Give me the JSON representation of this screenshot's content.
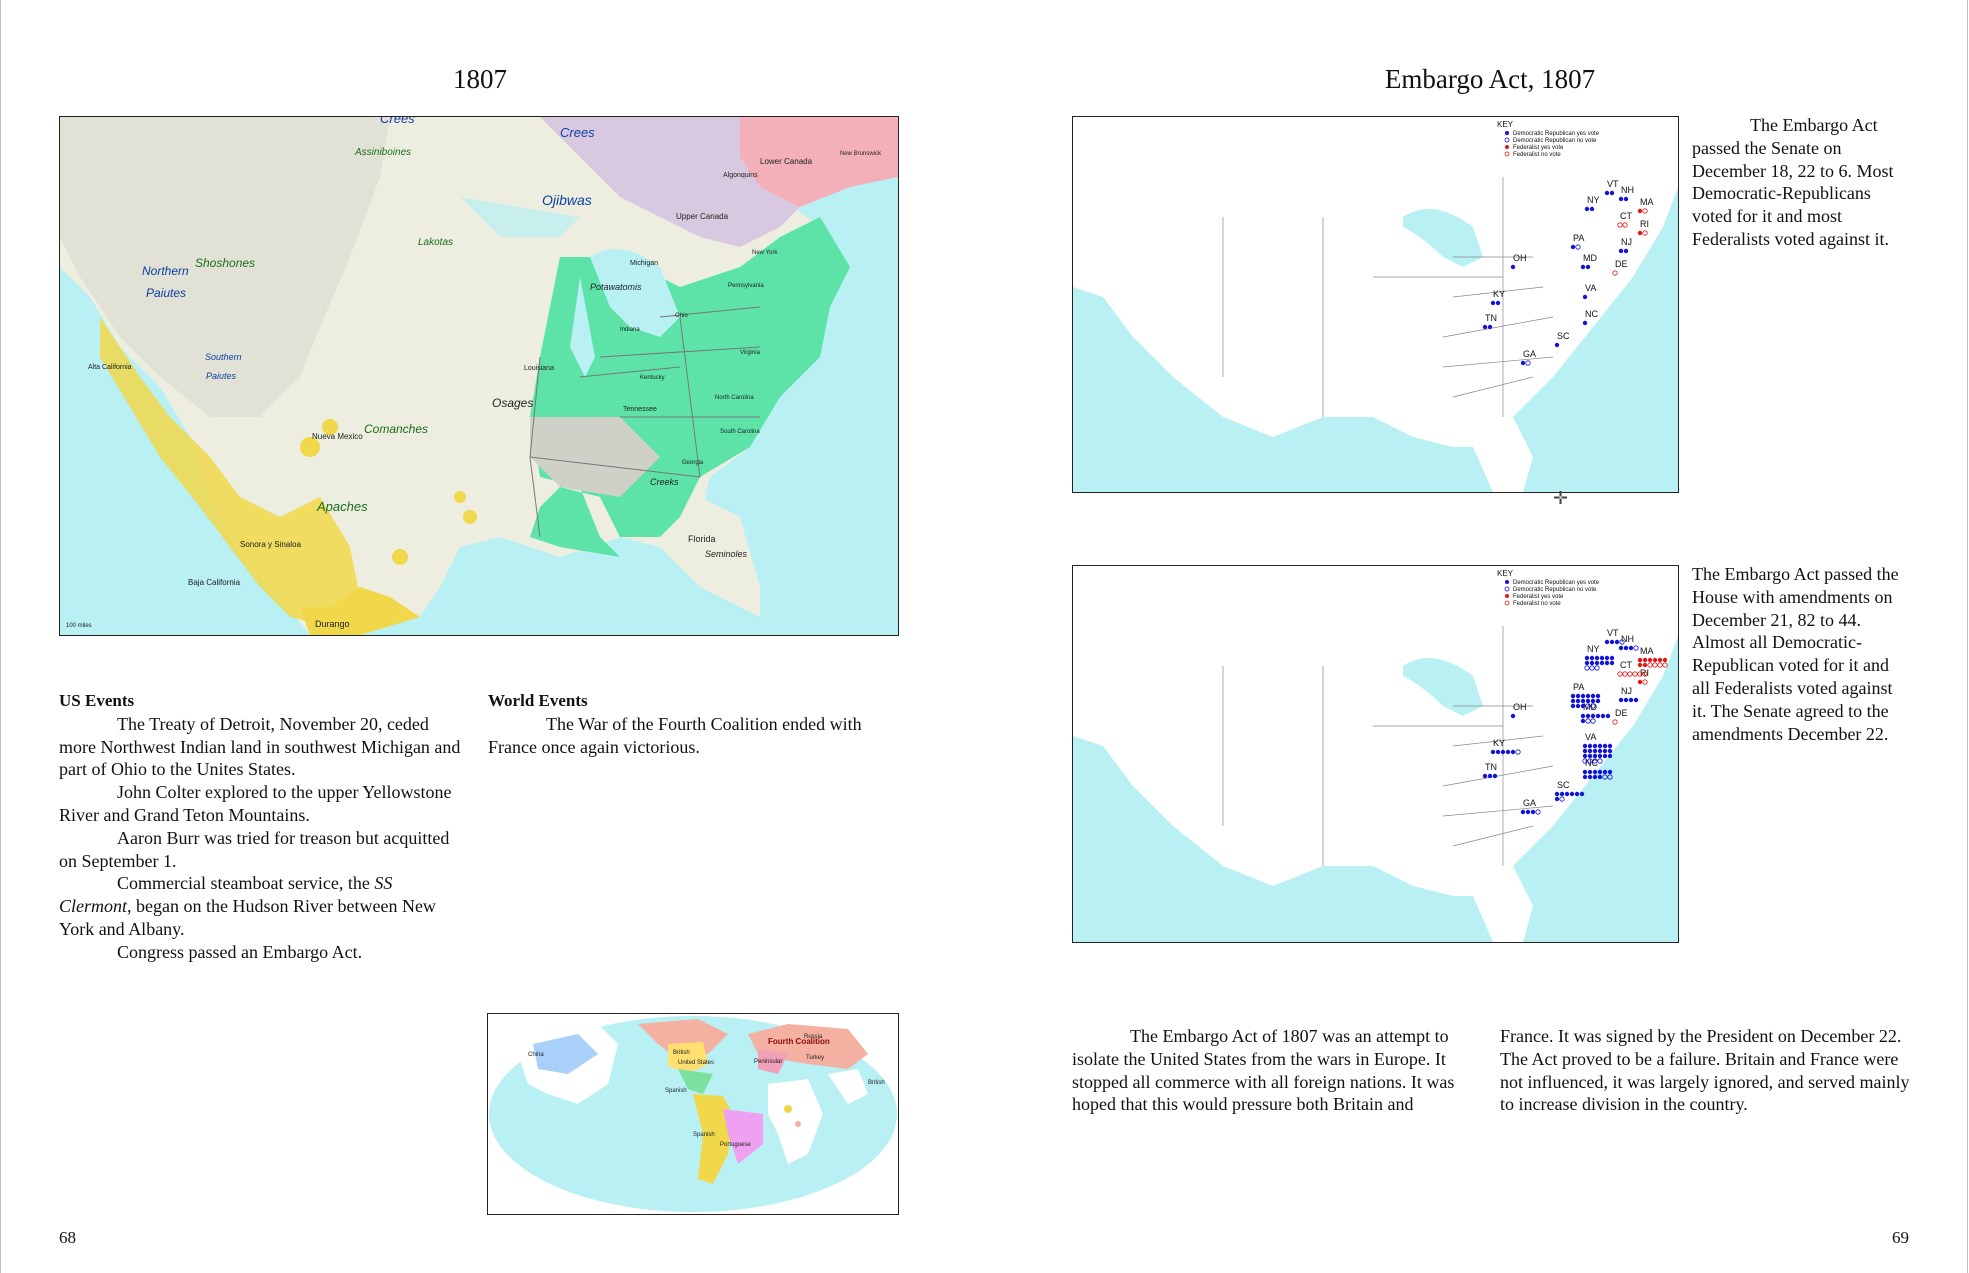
{
  "left_page": {
    "title": "1807",
    "page_number": "68",
    "us_events_heading": "US Events",
    "us_events": [
      "The Treaty of Detroit, November 20, ceded more Northwest Indian land in southwest Michigan and part of Ohio to the Unites States.",
      "John Colter explored to the upper Yellowstone River and Grand Teton Mountains.",
      "Aaron Burr was tried for treason but acquitted on September 1.",
      "Commercial steamboat service, the ",
      "SS Clermont",
      ", began on the Hudson River between New York and Albany.",
      "Congress passed an Embargo Act."
    ],
    "world_events_heading": "World Events",
    "world_events": [
      "The War of the Fourth Coalition ended with France once again victorious."
    ],
    "us_map_labels": {
      "crees_top": "Crees",
      "crees": "Crees",
      "assiniboines": "Assiniboines",
      "ojibwas": "Ojibwas",
      "shoshones": "Shoshones",
      "northern": "Northern",
      "paiutes": "Paiutes",
      "southern": "Southern",
      "paiutes2": "Paiutes",
      "comanches": "Comanches",
      "apaches": "Apaches",
      "osages": "Osages",
      "lakotas": "Lakotas",
      "potawatomis": "Potawatomis",
      "creeks": "Creeks",
      "seminoles": "Seminoles",
      "lower_canada": "Lower Canada",
      "upper_canada": "Upper Canada",
      "algonquins": "Algonquins",
      "new_brunswick": "New Brunswick",
      "michigan": "Michigan",
      "ohio": "Ohio",
      "indiana": "Indiana",
      "kentucky": "Kentucky",
      "tennessee": "Tennessee",
      "north_carolina": "North Carolina",
      "south_carolina": "South Carolina",
      "georgia": "Georgia",
      "virginia": "Virginia",
      "pennsylvania": "Pennsylvania",
      "new_york": "New York",
      "louisiana": "Louisiana",
      "nueva_mexico": "Nueva Mexico",
      "sonora": "Sonora y Sinaloa",
      "baja": "Baja California",
      "alta_california": "Alta California",
      "florida": "Florida",
      "durango": "Durango",
      "scale": "100 miles"
    },
    "world_map_labels": {
      "china": "China",
      "british": "British",
      "united_states": "United States",
      "spanish": "Spanish",
      "spanish2": "Spanish",
      "portuguese": "Portuguese",
      "fourth_coalition": "Fourth Coalition",
      "peninsular": "Peninsular",
      "russia": "Russia",
      "turkey": "Turkey",
      "british2": "British"
    }
  },
  "right_page": {
    "title": "Embargo Act, 1807",
    "page_number": "69",
    "senate_text": "The Embargo Act passed the Senate on December 18, 22 to 6. Most Democratic-Republicans voted for it and most Federalists voted against it.",
    "house_text": "The Embargo Act passed the House with amendments on December 21, 82 to 44. Almost all Democratic-Republican voted for it and all Federalists voted against it. The Senate agreed to the amendments December 22.",
    "bottom_col1": "The Embargo Act of 1807 was an attempt to isolate the United States from the wars in Europe. It stopped all commerce with all foreign nations. It was hoped that this would pressure both Britain and",
    "bottom_col2": "France. It was signed by the President on December 22. The Act proved to be a failure. Britain and France were not influenced, it was largely ignored, and served mainly to increase division in the country.",
    "key": {
      "title": "KEY",
      "items": [
        "Democratic Republican yes vote",
        "Democratic Republican no vote",
        "Federalist yes vote",
        "Federalist no vote"
      ],
      "colors": [
        "#1414d8",
        "#1414d8",
        "#e01818",
        "#e01818"
      ]
    },
    "states": [
      "VT",
      "NH",
      "MA",
      "NY",
      "CT",
      "RI",
      "PA",
      "NJ",
      "OH",
      "MD",
      "DE",
      "VA",
      "KY",
      "NC",
      "TN",
      "SC",
      "GA"
    ]
  }
}
